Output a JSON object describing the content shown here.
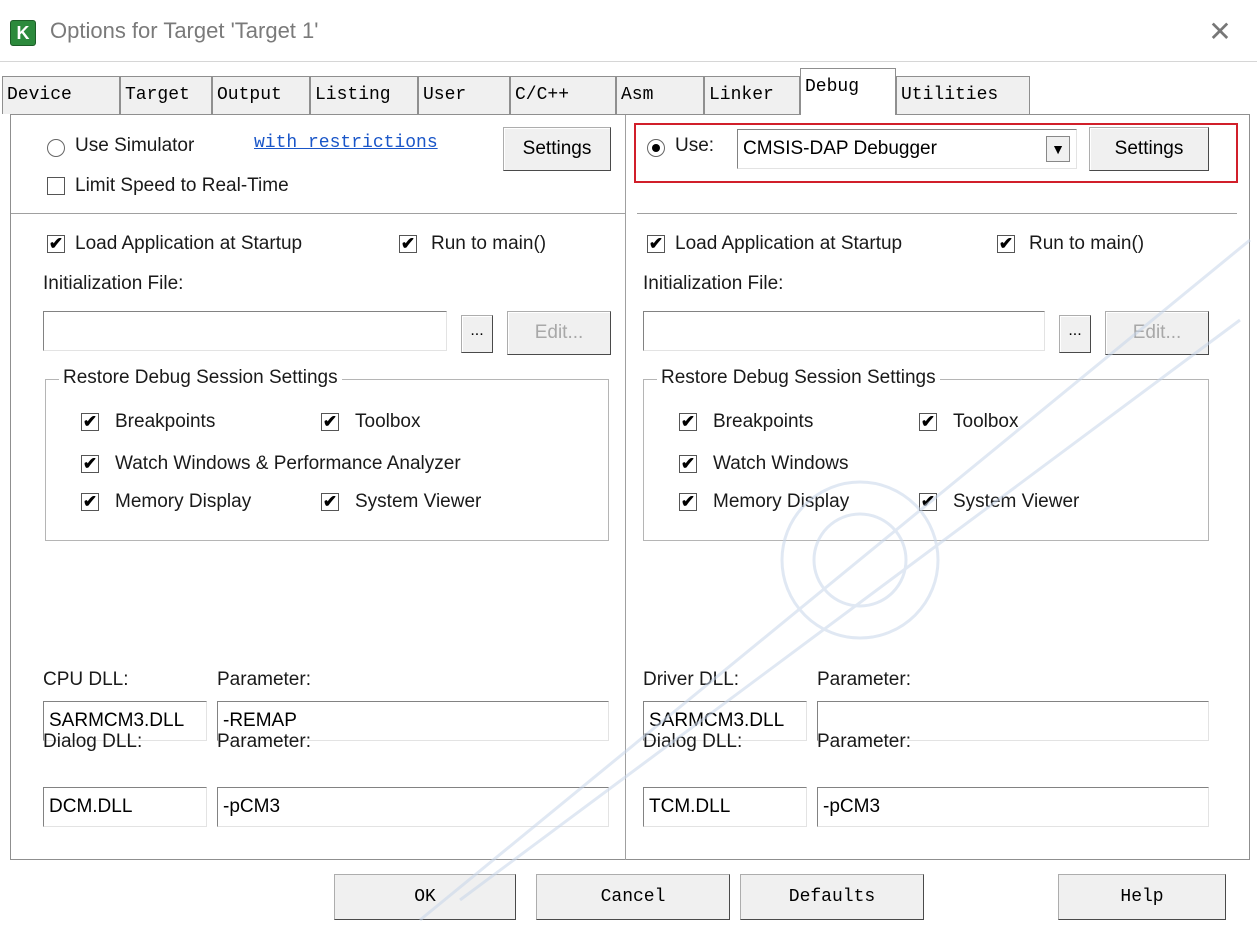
{
  "window": {
    "title": "Options for Target 'Target 1'",
    "icon": "keil-icon",
    "close_glyph": "✕"
  },
  "tabs": [
    {
      "label": "Device"
    },
    {
      "label": "Target"
    },
    {
      "label": "Output"
    },
    {
      "label": "Listing"
    },
    {
      "label": "User"
    },
    {
      "label": "C/C++"
    },
    {
      "label": "Asm"
    },
    {
      "label": "Linker"
    },
    {
      "label": "Debug",
      "active": true
    },
    {
      "label": "Utilities"
    }
  ],
  "left": {
    "use_simulator": "Use Simulator",
    "with_restrictions": "with restrictions",
    "settings": "Settings",
    "limit_speed": "Limit Speed to Real-Time",
    "load_app": "Load Application at Startup",
    "run_to_main": "Run to main()",
    "init_file_label": "Initialization File:",
    "init_file_value": "",
    "browse": "...",
    "edit": "Edit...",
    "restore_group": "Restore Debug Session Settings",
    "breakpoints": "Breakpoints",
    "toolbox": "Toolbox",
    "watch_windows": "Watch Windows & Performance Analyzer",
    "memory_display": "Memory Display",
    "system_viewer": "System Viewer",
    "cpu_dll_label": "CPU DLL:",
    "cpu_param_label": "Parameter:",
    "cpu_dll": "SARMCM3.DLL",
    "cpu_param": "-REMAP",
    "dialog_dll_label": "Dialog DLL:",
    "dialog_param_label": "Parameter:",
    "dialog_dll": "DCM.DLL",
    "dialog_param": "-pCM3"
  },
  "right": {
    "use": "Use:",
    "debugger": "CMSIS-DAP Debugger",
    "settings": "Settings",
    "load_app": "Load Application at Startup",
    "run_to_main": "Run to main()",
    "init_file_label": "Initialization File:",
    "init_file_value": "",
    "browse": "...",
    "edit": "Edit...",
    "restore_group": "Restore Debug Session Settings",
    "breakpoints": "Breakpoints",
    "toolbox": "Toolbox",
    "watch_windows": "Watch Windows",
    "memory_display": "Memory Display",
    "system_viewer": "System Viewer",
    "driver_dll_label": "Driver DLL:",
    "driver_param_label": "Parameter:",
    "driver_dll": "SARMCM3.DLL",
    "driver_param": "",
    "dialog_dll_label": "Dialog DLL:",
    "dialog_param_label": "Parameter:",
    "dialog_dll": "TCM.DLL",
    "dialog_param": "-pCM3"
  },
  "footer": {
    "ok": "OK",
    "cancel": "Cancel",
    "defaults": "Defaults",
    "help": "Help"
  },
  "checkmark": "✔",
  "dropdown_arrow": "▼",
  "colors": {
    "highlight": "#d11f2a",
    "link": "#1a56c8",
    "watermark": "#c8d6ea"
  }
}
